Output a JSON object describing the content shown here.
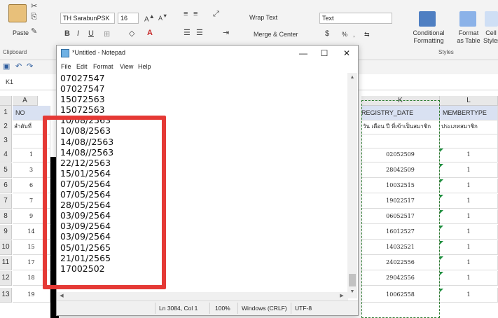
{
  "ribbon": {
    "clipboard": {
      "paste": "Paste",
      "group_label": "Clipboard"
    },
    "font": {
      "name": "TH SarabunPSK",
      "size": "16"
    },
    "alignment": {
      "wrap_text": "Wrap Text",
      "merge_center": "Merge & Center"
    },
    "number": {
      "format": "Text"
    },
    "styles": {
      "conditional_formatting": "Conditional Formatting",
      "format_as_table": "Format as Table",
      "cell_styles": "Cell Styles",
      "group_label": "Styles"
    }
  },
  "name_box": "K1",
  "grid": {
    "columns": {
      "a": "A",
      "k": "K",
      "l": "L"
    },
    "rows": [
      "1",
      "2",
      "3",
      "4",
      "5",
      "6",
      "7",
      "8",
      "9",
      "10",
      "11",
      "12",
      "13"
    ],
    "row1": {
      "a": "NO",
      "k": "REGISTRY_DATE",
      "l": "MEMBERTYPE"
    },
    "row2": {
      "a": "ลำดับที่",
      "k": "วัน เดือน ปี ที่เข้าเป็นสมาชิก",
      "l": "ประเภทสมาชิก"
    },
    "col_a": [
      "1",
      "3",
      "6",
      "7",
      "9",
      "14",
      "15",
      "17",
      "18",
      "19"
    ],
    "col_k": [
      "02052509",
      "28042509",
      "10032515",
      "19022517",
      "06052517",
      "16012527",
      "14032521",
      "24022556",
      "29042556",
      "10062558"
    ],
    "col_l": [
      "1",
      "1",
      "1",
      "1",
      "1",
      "1",
      "1",
      "1",
      "1",
      "1"
    ],
    "accent_color": "#e53935"
  },
  "notepad": {
    "title": "*Untitled - Notepad",
    "menu": [
      "File",
      "Edit",
      "Format",
      "View",
      "Help"
    ],
    "lines": [
      "07027547",
      "07027547",
      "15072563",
      "15072563",
      "10/08/2563",
      "10/08/2563",
      "14/08//2563",
      "14/08//2563",
      "22/12/2563",
      "15/01/2564",
      "07/05/2564",
      "07/05/2564",
      "28/05/2564",
      "03/09/2564",
      "03/09/2564",
      "03/09/2564",
      "05/01/2565",
      "21/01/2565",
      "17002502"
    ],
    "status": {
      "position": "Ln 3084, Col 1",
      "zoom": "100%",
      "line_ending": "Windows (CRLF)",
      "encoding": "UTF-8"
    }
  }
}
